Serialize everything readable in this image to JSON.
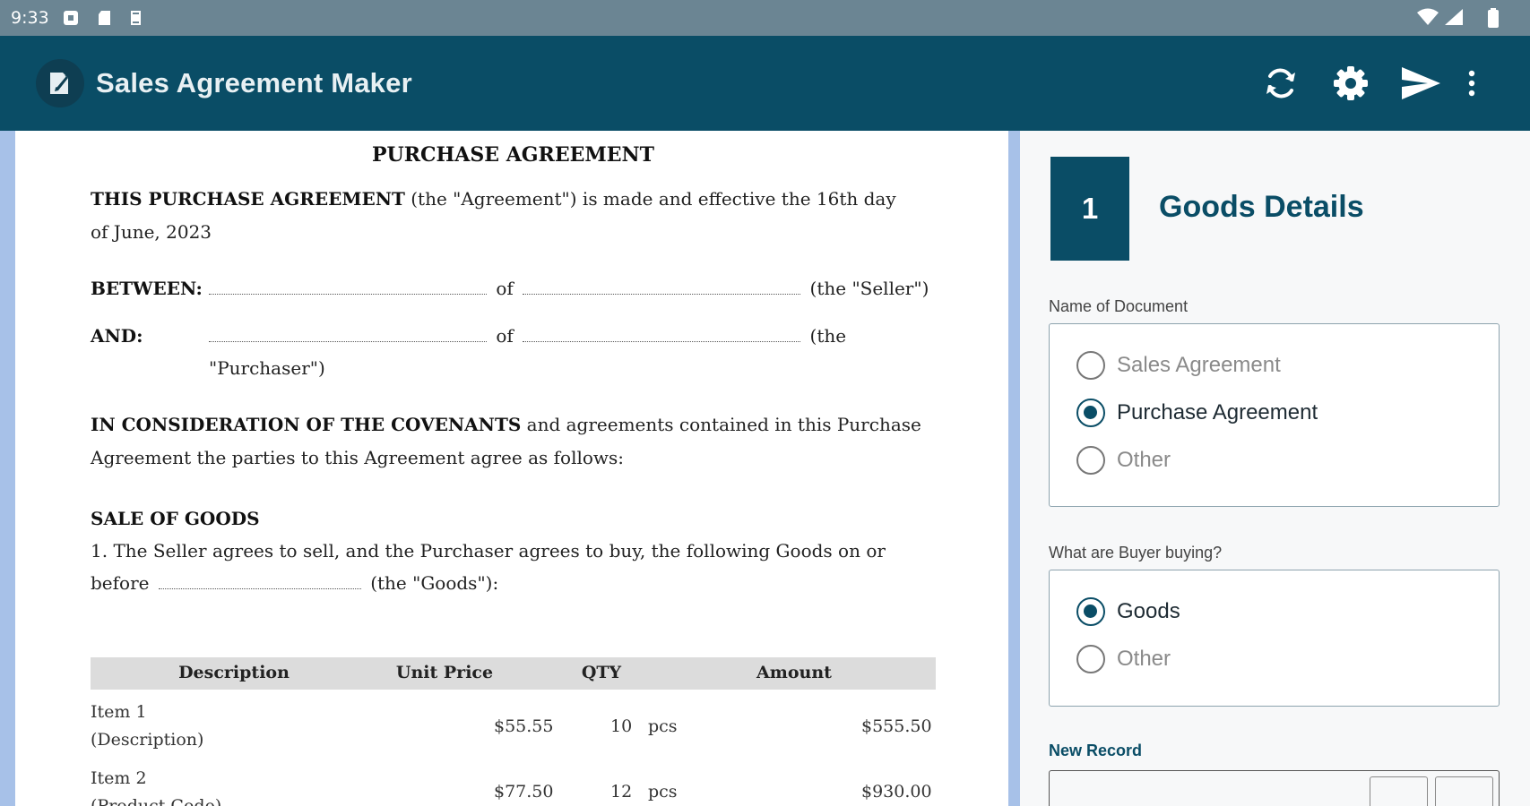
{
  "status_bar": {
    "time": "9:33",
    "left_icons": [
      "notification-icon",
      "sd-card-icon",
      "sync-status-icon"
    ],
    "right_icons": [
      "wifi-icon",
      "signal-icon",
      "battery-icon"
    ]
  },
  "app_bar": {
    "title": "Sales Agreement Maker",
    "logo_icon": "document-edit-icon",
    "actions": [
      "refresh-icon",
      "settings-icon",
      "send-icon",
      "more-vert-icon"
    ],
    "background": "#0a4d66"
  },
  "document": {
    "title": "PURCHASE AGREEMENT",
    "intro": {
      "bold": "THIS PURCHASE AGREEMENT",
      "line1": " (the \"Agreement\") is made and effective the 16th day",
      "line2": "of June, 2023"
    },
    "between": {
      "label": "BETWEEN:",
      "of": "of",
      "role": "(the \"Seller\")"
    },
    "and": {
      "label": "AND:",
      "of": "of",
      "role_line1": "(the",
      "role_line2": "\"Purchaser\")"
    },
    "consideration": {
      "bold": "IN CONSIDERATION OF THE COVENANTS",
      "line1": " and agreements contained in this Purchase",
      "line2": "Agreement the parties to this Agreement agree as follows:"
    },
    "sale_heading": "SALE OF GOODS",
    "sale_clause": {
      "line1": "1. The Seller agrees to sell, and the Purchaser agrees to buy, the following Goods on or",
      "line2_start": "before",
      "line2_end": "(the \"Goods\"):"
    },
    "table": {
      "headers": [
        "Description",
        "Unit Price",
        "QTY",
        "Amount"
      ],
      "rows": [
        {
          "item": "Item 1",
          "sub": "(Description)",
          "unit_price": "$55.55",
          "qty": "10",
          "unit": "pcs",
          "amount": "$555.50"
        },
        {
          "item": "Item 2",
          "sub": "(Product Code)",
          "unit_price": "$77.50",
          "qty": "12",
          "unit": "pcs",
          "amount": "$930.00"
        }
      ]
    }
  },
  "form": {
    "step_number": "1",
    "step_title": "Goods Details",
    "doc_name": {
      "label": "Name of Document",
      "options": [
        "Sales Agreement",
        "Purchase Agreement",
        "Other"
      ],
      "selected": "Purchase Agreement"
    },
    "buying": {
      "label": "What are Buyer buying?",
      "options": [
        "Goods",
        "Other"
      ],
      "selected": "Goods"
    },
    "new_record_label": "New Record"
  }
}
